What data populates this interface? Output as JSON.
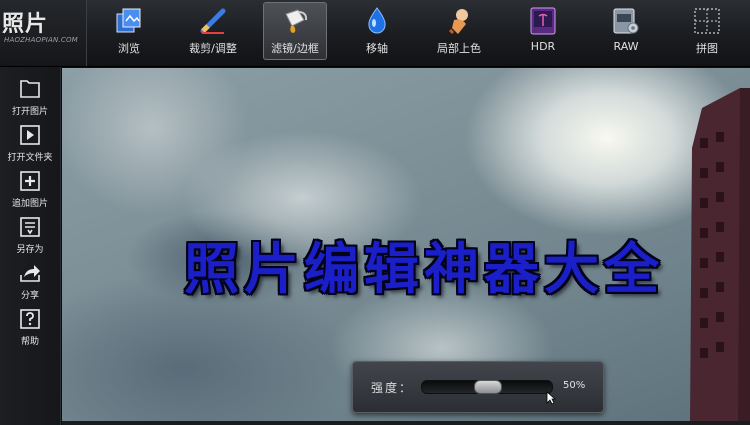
{
  "app": {
    "title": "照片",
    "subtitle": "HAOZHAOPIAN.COM"
  },
  "toolbar": {
    "items": [
      {
        "label": "浏览",
        "icon": "browse-icon",
        "active": false
      },
      {
        "label": "裁剪/调整",
        "icon": "crop-adjust-icon",
        "active": false
      },
      {
        "label": "滤镜/边框",
        "icon": "filter-frame-icon",
        "active": true
      },
      {
        "label": "移轴",
        "icon": "tilt-shift-drop-icon",
        "active": false
      },
      {
        "label": "局部上色",
        "icon": "local-color-icon",
        "active": false
      },
      {
        "label": "HDR",
        "icon": "hdr-icon",
        "active": false
      },
      {
        "label": "RAW",
        "icon": "raw-icon",
        "active": false
      },
      {
        "label": "拼图",
        "icon": "collage-icon",
        "active": false
      }
    ]
  },
  "sidebar": {
    "items": [
      {
        "label": "打开图片",
        "icon": "open-image-icon"
      },
      {
        "label": "打开文件夹",
        "icon": "open-folder-icon"
      },
      {
        "label": "追加图片",
        "icon": "add-image-icon"
      },
      {
        "label": "另存为",
        "icon": "save-as-icon"
      },
      {
        "label": "分享",
        "icon": "share-icon"
      },
      {
        "label": "帮助",
        "icon": "help-icon"
      }
    ]
  },
  "canvas": {
    "headline": "照片编辑神器大全"
  },
  "intensity": {
    "label": "强度：",
    "value_text": "50%",
    "value": 0.5
  },
  "colors": {
    "toolbar_bg": "#1a1c20",
    "headline_fill": "#1a1fc8",
    "active_tool_bg": "#4e5156"
  }
}
